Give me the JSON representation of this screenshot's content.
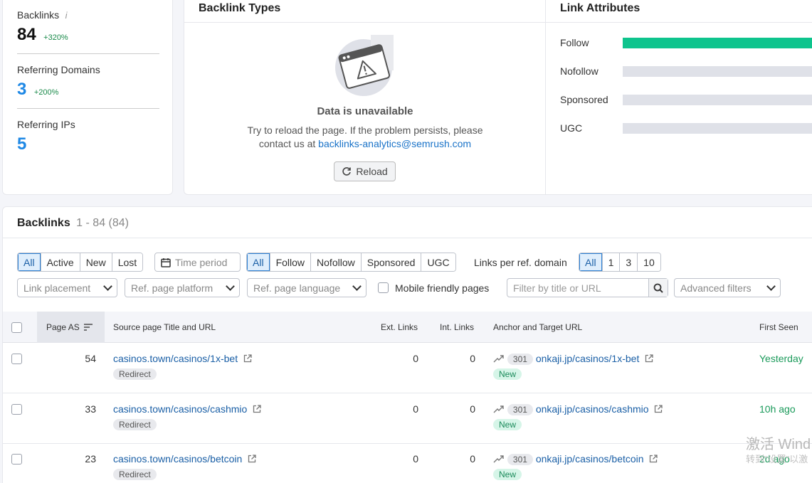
{
  "stats": {
    "backlinks": {
      "label": "Backlinks",
      "value": "84",
      "change": "+320%"
    },
    "referring_domains": {
      "label": "Referring Domains",
      "value": "3",
      "change": "+200%"
    },
    "referring_ips": {
      "label": "Referring IPs",
      "value": "5"
    }
  },
  "backlink_types": {
    "title": "Backlink Types",
    "unavailable_title": "Data is unavailable",
    "unavailable_text_1": "Try to reload the page. If the problem persists, please",
    "unavailable_text_2": "contact us at",
    "email": "backlinks-analytics@semrush.com",
    "reload_label": "Reload"
  },
  "link_attributes": {
    "title": "Link Attributes",
    "items": [
      {
        "label": "Follow",
        "fill": 1.0
      },
      {
        "label": "Nofollow",
        "fill": 0
      },
      {
        "label": "Sponsored",
        "fill": 0
      },
      {
        "label": "UGC",
        "fill": 0
      }
    ],
    "colors": {
      "follow": "#0ec48d",
      "empty": "#dfe1e8"
    }
  },
  "backlinks": {
    "title": "Backlinks",
    "count": "1 - 84 (84)",
    "status_filter": [
      "All",
      "Active",
      "New",
      "Lost"
    ],
    "time_period": "Time period",
    "attr_filter": [
      "All",
      "Follow",
      "Nofollow",
      "Sponsored",
      "UGC"
    ],
    "links_per_domain_label": "Links per ref. domain",
    "links_per_domain": [
      "All",
      "1",
      "3",
      "10"
    ],
    "dropdowns": {
      "link_placement": "Link placement",
      "ref_page_platform": "Ref. page platform",
      "ref_page_language": "Ref. page language",
      "advanced_filters": "Advanced filters"
    },
    "mobile_friendly_label": "Mobile friendly pages",
    "search_placeholder": "Filter by title or URL",
    "columns": {
      "page_as": "Page AS",
      "source": "Source page Title and URL",
      "ext_links": "Ext. Links",
      "int_links": "Int. Links",
      "anchor": "Anchor and Target URL",
      "first_seen": "First Seen"
    },
    "rows": [
      {
        "page_as": "54",
        "source_url": "casinos.town/casinos/1x-bet",
        "source_tag": "Redirect",
        "ext": "0",
        "int": "0",
        "code": "301",
        "target_url": "onkaji.jp/casinos/1x-bet",
        "target_tag": "New",
        "first_seen": "Yesterday"
      },
      {
        "page_as": "33",
        "source_url": "casinos.town/casinos/cashmio",
        "source_tag": "Redirect",
        "ext": "0",
        "int": "0",
        "code": "301",
        "target_url": "onkaji.jp/casinos/cashmio",
        "target_tag": "New",
        "first_seen": "10h ago"
      },
      {
        "page_as": "23",
        "source_url": "casinos.town/casinos/betcoin",
        "source_tag": "Redirect",
        "ext": "0",
        "int": "0",
        "code": "301",
        "target_url": "onkaji.jp/casinos/betcoin",
        "target_tag": "New",
        "first_seen": "2d ago"
      }
    ]
  },
  "watermark": {
    "line1": "激活 Wind",
    "line2": "转到\"设置\"以激"
  }
}
